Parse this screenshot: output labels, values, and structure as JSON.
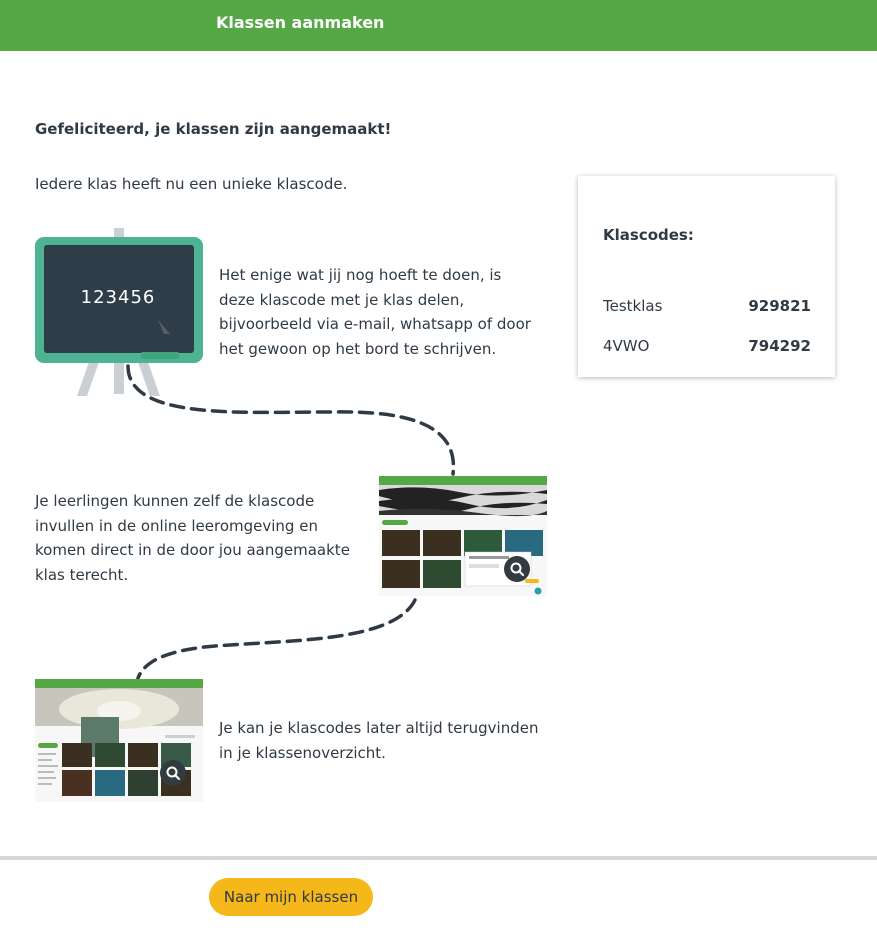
{
  "header": {
    "title": "Klassen aanmaken"
  },
  "content": {
    "congrats": "Gefeliciteerd, je klassen zijn aangemaakt!",
    "intro": "Iedere klas heeft nu een unieke klascode.",
    "board_code": "123456",
    "step1": "Het enige wat jij nog hoeft te doen, is deze klascode met je klas delen, bijvoorbeeld via e-mail, whatsapp of door het gewoon op het bord te schrijven.",
    "step2": "Je leerlingen kunnen zelf de klascode invullen in de online leeromgeving en komen direct in de door jou aangemaakte klas terecht.",
    "step3": "Je kan je klascodes later altijd terugvinden in je klassenoverzicht."
  },
  "codes_card": {
    "title": "Klascodes:",
    "rows": [
      {
        "name": "Testklas",
        "code": "929821"
      },
      {
        "name": "4VWO",
        "code": "794292"
      }
    ]
  },
  "footer": {
    "button_label": "Naar mijn klassen"
  },
  "colors": {
    "header": "#56a745",
    "button": "#f5b719",
    "board": "#2f3d49",
    "board_frame": "#4eb393",
    "text": "#2f3a44"
  },
  "icons": {
    "zoom": "magnifier-icon"
  }
}
